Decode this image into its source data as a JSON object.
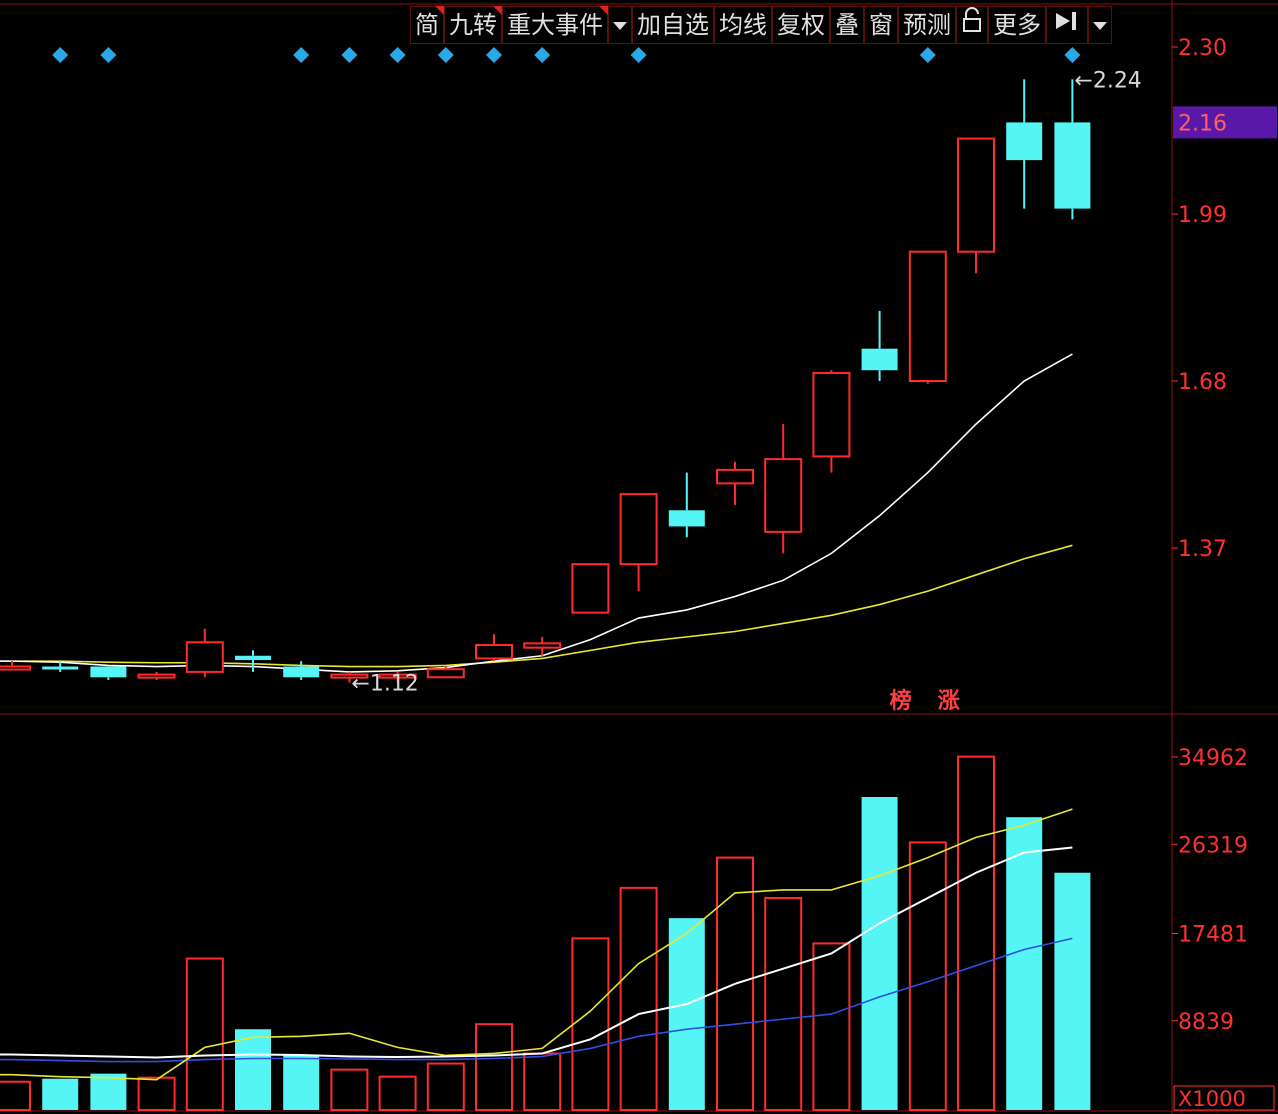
{
  "toolbar": {
    "items": [
      {
        "label": "简",
        "flag": true
      },
      {
        "label": "九转",
        "flag": true
      },
      {
        "label": "重大事件",
        "flag": true
      },
      {
        "label": "",
        "icon": "dropdown-arrow-icon"
      },
      {
        "label": "加自选"
      },
      {
        "label": "均线"
      },
      {
        "label": "复权"
      },
      {
        "label": "叠"
      },
      {
        "label": "窗"
      },
      {
        "label": "预测"
      },
      {
        "label": "",
        "icon": "lock-icon"
      },
      {
        "label": "更多"
      },
      {
        "label": "",
        "icon": "skip-to-end-icon"
      },
      {
        "label": "",
        "icon": "dropdown-arrow-icon"
      }
    ]
  },
  "colors": {
    "background": "#000000",
    "up": "#ff2a2a",
    "down": "#55f5f5",
    "axis_text": "#ff3030",
    "ma_white": "#ffffff",
    "ma_yellow": "#e8e830",
    "ma_blue": "#3050e0",
    "marker": "#2aa8e8",
    "current_price_bg": "#5a18a8"
  },
  "chart_data": [
    {
      "type": "candlestick",
      "y_ticks": [
        "2.30",
        "1.99",
        "1.68",
        "1.37"
      ],
      "current_price_label": "2.16",
      "ylim": [
        1.05,
        2.32
      ],
      "candles": [
        {
          "o": 1.15,
          "h": 1.16,
          "l": 1.145,
          "c": 1.15
        },
        {
          "o": 1.15,
          "h": 1.16,
          "l": 1.14,
          "c": 1.145
        },
        {
          "o": 1.15,
          "h": 1.15,
          "l": 1.125,
          "c": 1.13
        },
        {
          "o": 1.13,
          "h": 1.14,
          "l": 1.125,
          "c": 1.135
        },
        {
          "o": 1.14,
          "h": 1.22,
          "l": 1.13,
          "c": 1.195
        },
        {
          "o": 1.17,
          "h": 1.18,
          "l": 1.14,
          "c": 1.162
        },
        {
          "o": 1.15,
          "h": 1.16,
          "l": 1.125,
          "c": 1.13
        },
        {
          "o": 1.13,
          "h": 1.14,
          "l": 1.12,
          "c": 1.135
        },
        {
          "o": 1.13,
          "h": 1.14,
          "l": 1.12,
          "c": 1.135
        },
        {
          "o": 1.13,
          "h": 1.15,
          "l": 1.13,
          "c": 1.145
        },
        {
          "o": 1.165,
          "h": 1.21,
          "l": 1.16,
          "c": 1.19
        },
        {
          "o": 1.185,
          "h": 1.205,
          "l": 1.17,
          "c": 1.193
        },
        {
          "o": 1.25,
          "h": 1.34,
          "l": 1.25,
          "c": 1.34
        },
        {
          "o": 1.34,
          "h": 1.47,
          "l": 1.29,
          "c": 1.47
        },
        {
          "o": 1.44,
          "h": 1.51,
          "l": 1.39,
          "c": 1.41
        },
        {
          "o": 1.49,
          "h": 1.53,
          "l": 1.45,
          "c": 1.515
        },
        {
          "o": 1.4,
          "h": 1.6,
          "l": 1.36,
          "c": 1.535
        },
        {
          "o": 1.54,
          "h": 1.7,
          "l": 1.51,
          "c": 1.695
        },
        {
          "o": 1.74,
          "h": 1.81,
          "l": 1.68,
          "c": 1.7
        },
        {
          "o": 1.68,
          "h": 1.92,
          "l": 1.675,
          "c": 1.92
        },
        {
          "o": 1.92,
          "h": 2.13,
          "l": 1.88,
          "c": 2.13
        },
        {
          "o": 2.16,
          "h": 2.24,
          "l": 2.0,
          "c": 2.09
        },
        {
          "o": 2.16,
          "h": 2.24,
          "l": 1.98,
          "c": 2.0
        }
      ],
      "ma_white": [
        1.16,
        1.158,
        1.152,
        1.15,
        1.152,
        1.15,
        1.145,
        1.14,
        1.142,
        1.148,
        1.16,
        1.17,
        1.2,
        1.24,
        1.255,
        1.28,
        1.31,
        1.36,
        1.43,
        1.51,
        1.6,
        1.68,
        1.73
      ],
      "ma_yellow": [
        1.16,
        1.16,
        1.158,
        1.157,
        1.157,
        1.155,
        1.152,
        1.15,
        1.15,
        1.152,
        1.158,
        1.165,
        1.18,
        1.195,
        1.205,
        1.215,
        1.23,
        1.245,
        1.265,
        1.29,
        1.32,
        1.35,
        1.375
      ],
      "annotations": [
        {
          "text": "←2.24",
          "index": 22,
          "value": 2.24
        },
        {
          "text": "←1.12",
          "index": 7,
          "value": 1.12
        }
      ],
      "event_labels": [
        "榜",
        "涨"
      ],
      "event_label_indices": [
        18,
        19
      ],
      "top_markers": [
        1,
        2,
        6,
        7,
        8,
        9,
        10,
        11,
        13,
        19,
        22
      ]
    },
    {
      "type": "bar",
      "y_ticks": [
        "34962",
        "26319",
        "17481",
        "8839"
      ],
      "unit_label": "X1000",
      "ylim": [
        0,
        37000
      ],
      "volumes": [
        2800,
        3100,
        3600,
        3200,
        15000,
        8000,
        5400,
        4000,
        3300,
        4600,
        8500,
        5600,
        17000,
        22000,
        19000,
        25000,
        21000,
        16500,
        31000,
        26500,
        35000,
        29000,
        23500
      ],
      "ma_white": [
        5500,
        5400,
        5300,
        5200,
        5400,
        5500,
        5450,
        5300,
        5250,
        5300,
        5400,
        5600,
        7000,
        9500,
        10500,
        12500,
        14000,
        15500,
        18500,
        21000,
        23500,
        25500,
        26000
      ],
      "ma_yellow": [
        3500,
        3300,
        3200,
        3000,
        6200,
        7200,
        7300,
        7600,
        6200,
        5400,
        5600,
        6100,
        9800,
        14500,
        17500,
        21500,
        21800,
        21800,
        23200,
        25000,
        27000,
        28200,
        29800
      ],
      "ma_blue": [
        5000,
        4900,
        4800,
        4800,
        5000,
        5100,
        5100,
        5050,
        5000,
        5000,
        5100,
        5300,
        6100,
        7300,
        8000,
        8500,
        9000,
        9500,
        11200,
        12700,
        14300,
        15900,
        17000
      ]
    }
  ]
}
